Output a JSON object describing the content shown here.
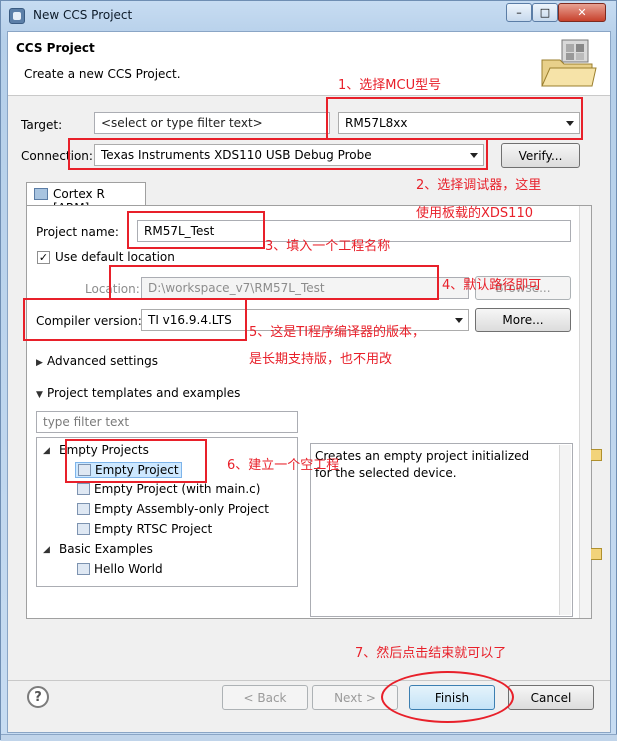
{
  "window": {
    "title": "New CCS Project",
    "minimize": "–",
    "maximize": "□",
    "close": "✕"
  },
  "header": {
    "title": "CCS Project",
    "description": "Create a new CCS Project."
  },
  "target": {
    "label": "Target:",
    "filter_placeholder": "<select or type filter text>",
    "value": "RM57L8xx"
  },
  "connection": {
    "label": "Connection:",
    "value": "Texas Instruments XDS110 USB Debug Probe",
    "verify_label": "Verify..."
  },
  "tab": {
    "label": "Cortex R [ARM]"
  },
  "project": {
    "name_label": "Project name:",
    "name_value": "RM57L_Test",
    "use_default_label": "Use default location",
    "location_label": "Location:",
    "location_value": "D:\\workspace_v7\\RM57L_Test",
    "browse_label": "Browse...",
    "compiler_label": "Compiler version:",
    "compiler_value": "TI v16.9.4.LTS",
    "more_label": "More...",
    "advanced_label": "Advanced settings",
    "templates_label": "Project templates and examples",
    "filter_placeholder": "type filter text"
  },
  "tree": [
    {
      "label": "Empty Projects"
    },
    {
      "label": "Empty Project"
    },
    {
      "label": "Empty Project (with main.c)"
    },
    {
      "label": "Empty Assembly-only Project"
    },
    {
      "label": "Empty RTSC Project"
    },
    {
      "label": "Basic Examples"
    },
    {
      "label": "Hello World"
    }
  ],
  "description": "Creates an empty project initialized for the selected device.",
  "buttons": {
    "help": "?",
    "back": "< Back",
    "next": "Next >",
    "finish": "Finish",
    "cancel": "Cancel"
  },
  "annotations": {
    "a1": "1、选择MCU型号",
    "a2": "2、选择调试器，这里",
    "a2b": "使用板载的XDS110",
    "a3": "3、填入一个工程名称",
    "a4": "4、默认路径即可",
    "a5": "5、这是TI程序编译器的版本，",
    "a5b": "是长期支持版，也不用改",
    "a6": "6、建立一个空工程",
    "a7": "7、然后点击结束就可以了"
  },
  "colors": {
    "annotation": "#e8202a",
    "title_bar": "#c7dcf2"
  }
}
